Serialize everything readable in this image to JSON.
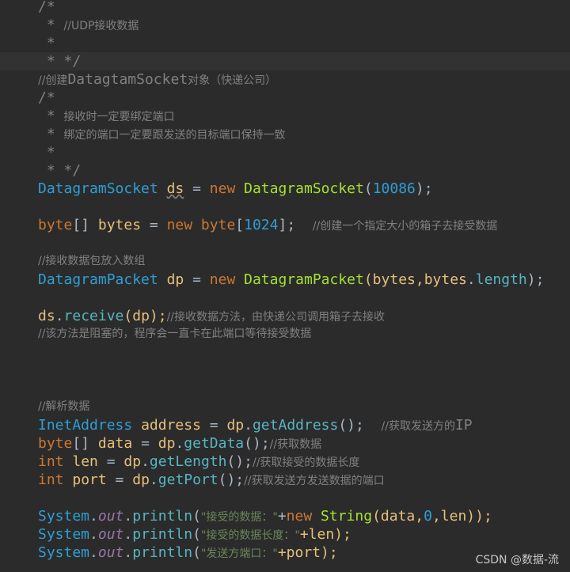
{
  "code": {
    "l1": "/*",
    "l2a": " * ",
    "l2b": "//UDP接收数据",
    "l3": " *",
    "l4": " * */",
    "l5a": "//创建",
    "l5b": "DatagtamSocket",
    "l5c": "对象（快递公司）",
    "l6": "/*",
    "l7a": " * ",
    "l7b": "接收时一定要绑定端口",
    "l8a": " * ",
    "l8b": "绑定的端口一定要跟发送的目标端口保持一致",
    "l9": " *",
    "l10": " * */",
    "l11": {
      "type": "DatagramSocket",
      "var": "ds",
      "eq": " = ",
      "kw": "new",
      "ctor": "DatagramSocket",
      "p1": "(",
      "num": "10086",
      "p2": ");"
    },
    "l12": {
      "kw": "byte",
      "br": "[] ",
      "var": "bytes",
      "eq": " = ",
      "new": "new",
      "kw2": " byte",
      "b1": "[",
      "num": "1024",
      "b2": "];  ",
      "cm": "//创建一个指定大小的箱子去接受数据"
    },
    "l13": "//接收数据包放入数组",
    "l14": {
      "type": "DatagramPacket",
      "var": "dp",
      "eq": " = ",
      "kw": "new",
      "ctor": "DatagramPacket",
      "args": "(bytes,",
      "arg2": "bytes",
      "dot": ".",
      "fld": "length",
      "end": ");"
    },
    "l15": {
      "var": "ds",
      "dot": ".",
      "mth": "receive",
      "args": "(dp);",
      "cm": "//接收数据方法，由快递公司调用箱子去接收"
    },
    "l16": "//该方法是阻塞的，程序会一直卡在此端口等待接受数据",
    "l17": "//解析数据",
    "l18": {
      "type": "InetAddress",
      "var": "address",
      "eq": " = ",
      "obj": "dp",
      "dot": ".",
      "mth": "getAddress",
      "end": "();  ",
      "cm": "//获取发送方的",
      "cm2": "IP"
    },
    "l19": {
      "kw": "byte",
      "br": "[] ",
      "var": "data",
      "eq": " = ",
      "obj": "dp",
      "dot": ".",
      "mth": "getData",
      "end": "();",
      "cm": "//获取数据"
    },
    "l20": {
      "kw": "int",
      "var": "len",
      "eq": " = ",
      "obj": "dp",
      "dot": ".",
      "mth": "getLength",
      "end": "();",
      "cm": "//获取接受的数据长度"
    },
    "l21": {
      "kw": "int",
      "var": "port",
      "eq": " = ",
      "obj": "dp",
      "dot": ".",
      "mth": "getPort",
      "end": "();",
      "cm": "//获取发送方发送数据的端口"
    },
    "l22": {
      "sys": "System",
      "dot": ".",
      "out": "out",
      "pr": "println",
      "p1": "(",
      "str": "\"接受的数据：\"",
      "plus": "+",
      "kw": "new",
      "sp": " ",
      "cls": "String",
      "args": "(data,",
      "num": "0",
      "rest": ",len));"
    },
    "l23": {
      "sys": "System",
      "dot": ".",
      "out": "out",
      "pr": "println",
      "p1": "(",
      "str": "\"接受的数据长度：\"",
      "rest": "+len);"
    },
    "l24": {
      "sys": "System",
      "dot": ".",
      "out": "out",
      "pr": "println",
      "p1": "(",
      "str": "\"发送方端口：\"",
      "rest": "+port);"
    }
  },
  "watermark": "CSDN @数据-流"
}
